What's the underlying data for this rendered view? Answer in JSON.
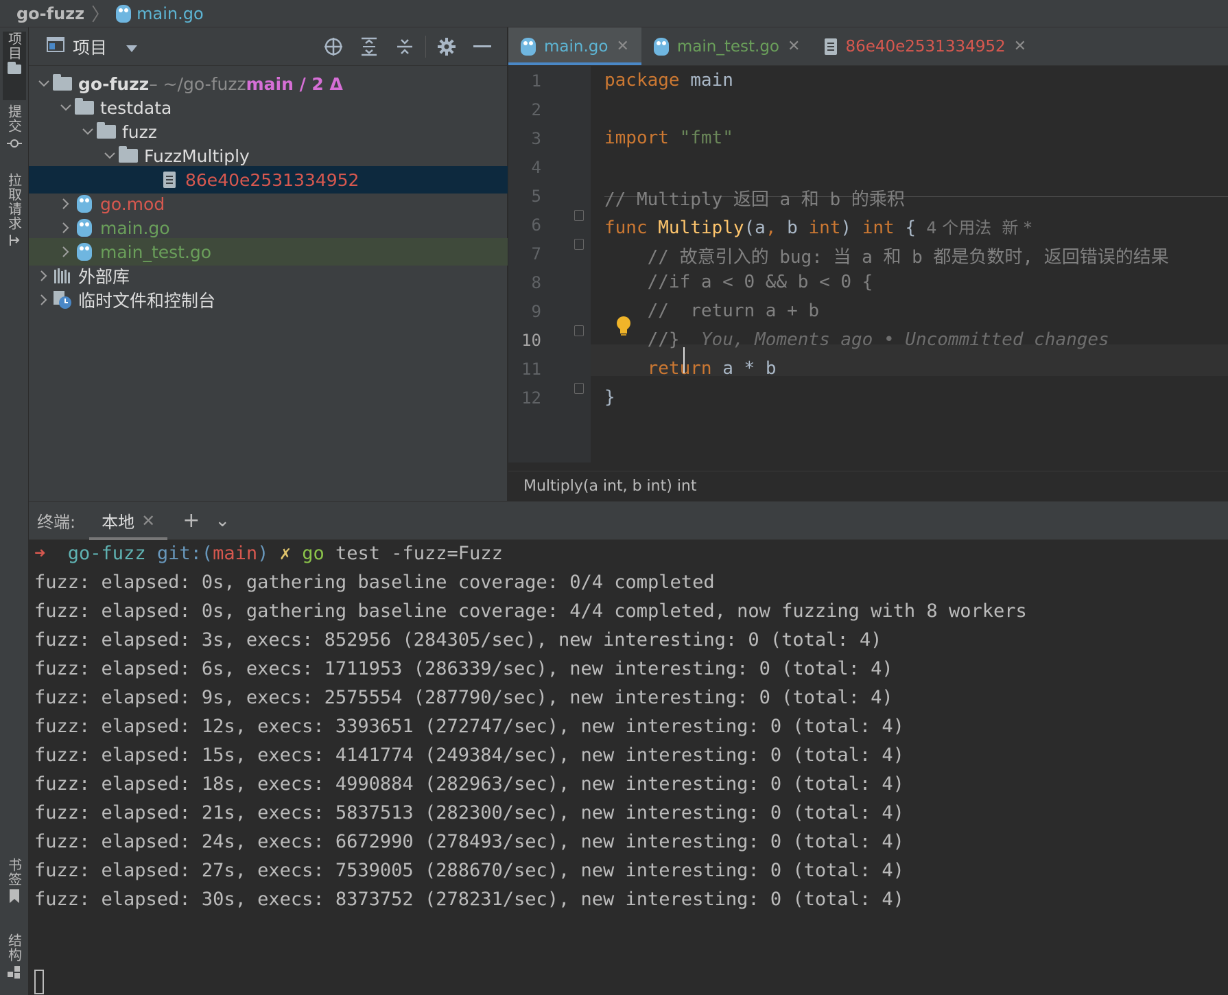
{
  "breadcrumb": {
    "project": "go-fuzz",
    "separator": "〉",
    "file": "main.go"
  },
  "left_stripe": [
    "项目",
    "提交",
    "拉取请求",
    "书签",
    "结构"
  ],
  "project_panel": {
    "title": "项目",
    "icons": [
      "crosshair-icon",
      "expand-all-icon",
      "collapse-all-icon",
      "gear-icon",
      "minimize-icon"
    ],
    "tree": [
      {
        "label": "go-fuzz",
        "suffix": " – ~/go-fuzz ",
        "branch": "main / 2 Δ"
      },
      {
        "label": "testdata"
      },
      {
        "label": "fuzz"
      },
      {
        "label": "FuzzMultiply"
      },
      {
        "label": "86e40e2531334952"
      },
      {
        "label": "go.mod"
      },
      {
        "label": "main.go"
      },
      {
        "label": "main_test.go"
      },
      {
        "label": "外部库"
      },
      {
        "label": "临时文件和控制台"
      }
    ]
  },
  "tabs": [
    {
      "label": "main.go",
      "active": true
    },
    {
      "label": "main_test.go"
    },
    {
      "label": "86e40e2531334952"
    }
  ],
  "editor": {
    "line_numbers": [
      "1",
      "2",
      "3",
      "4",
      "5",
      "6",
      "7",
      "8",
      "9",
      "10",
      "11",
      "12"
    ],
    "current_line": "10",
    "code": {
      "l1_kw": "package",
      "l1_rest": " main",
      "l3_kw": "import",
      "l3_str": " \"fmt\"",
      "l5_comment": "// Multiply 返回 a 和 b 的乘积",
      "l6_kw1": "func",
      "l6_fn": " Multiply",
      "l6_p1": "(a",
      "l6_comma": ",",
      "l6_p2": " b ",
      "l6_int1": "int",
      "l6_p3": ") ",
      "l6_int2": "int",
      "l6_brace": " {",
      "l6_hint": "  4 个用法  新 *",
      "l7_comment": "    // 故意引入的 bug: 当 a 和 b 都是负数时, 返回错误的结果",
      "l8_comment": "    //if a < 0 && b < 0 {",
      "l9_comment": "    //  return a + b",
      "l10_comment": "    //}",
      "l10_blame": "  You, Moments ago • Uncommitted changes",
      "l11_kw": "    return",
      "l11_rest": " a * b",
      "l12": "}"
    },
    "footer": "Multiply(a int, b int) int"
  },
  "terminal": {
    "label": "终端:",
    "tab": "本地",
    "add": "+",
    "more": "⌄",
    "prompt": {
      "arrow": "➜",
      "dir": "go-fuzz",
      "git": "git:(",
      "branch": "main",
      "git_close": ")",
      "x": "✗",
      "cmd": "go",
      "args": " test -fuzz=Fuzz"
    },
    "lines": [
      "fuzz: elapsed: 0s, gathering baseline coverage: 0/4 completed",
      "fuzz: elapsed: 0s, gathering baseline coverage: 4/4 completed, now fuzzing with 8 workers",
      "fuzz: elapsed: 3s, execs: 852956 (284305/sec), new interesting: 0 (total: 4)",
      "fuzz: elapsed: 6s, execs: 1711953 (286339/sec), new interesting: 0 (total: 4)",
      "fuzz: elapsed: 9s, execs: 2575554 (287790/sec), new interesting: 0 (total: 4)",
      "fuzz: elapsed: 12s, execs: 3393651 (272747/sec), new interesting: 0 (total: 4)",
      "fuzz: elapsed: 15s, execs: 4141774 (249384/sec), new interesting: 0 (total: 4)",
      "fuzz: elapsed: 18s, execs: 4990884 (282963/sec), new interesting: 0 (total: 4)",
      "fuzz: elapsed: 21s, execs: 5837513 (282300/sec), new interesting: 0 (total: 4)",
      "fuzz: elapsed: 24s, execs: 6672990 (278493/sec), new interesting: 0 (total: 4)",
      "fuzz: elapsed: 27s, execs: 7539005 (288670/sec), new interesting: 0 (total: 4)",
      "fuzz: elapsed: 30s, execs: 8373752 (278231/sec), new interesting: 0 (total: 4)"
    ]
  },
  "colors": {
    "accent": "#4a88c7",
    "selection": "#0d293e",
    "vcs_modified": "#6897bb",
    "vcs_unversioned": "#d7584f",
    "vcs_added": "#629755"
  }
}
